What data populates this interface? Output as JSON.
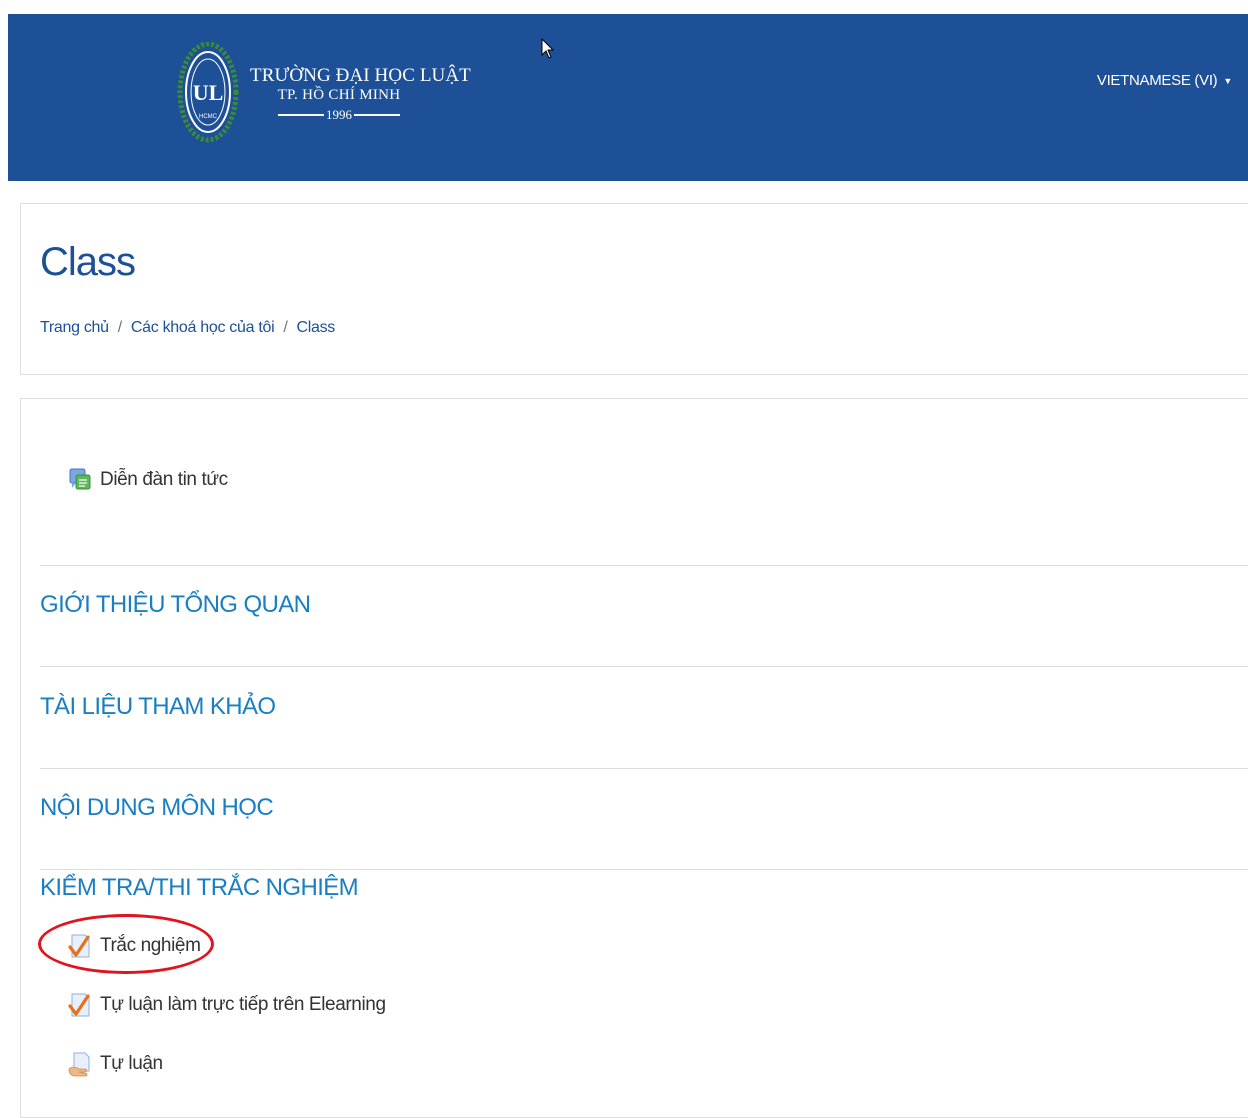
{
  "header": {
    "logo": {
      "emblem_letters": "UL",
      "emblem_caption": "HCMC",
      "line1": "TRƯỜNG ĐẠI HỌC LUẬT",
      "line2": "TP. HỒ CHÍ MINH",
      "year": "1996"
    },
    "language_label": "VIETNAMESE (VI)",
    "brand_color": "#1d5096"
  },
  "page": {
    "title": "Class",
    "breadcrumb": [
      "Trang chủ",
      "Các khoá học của tôi",
      "Class"
    ],
    "breadcrumb_separator": "/"
  },
  "course": {
    "forum": {
      "label": "Diễn đàn tin tức",
      "icon": "forum-icon"
    },
    "sections": [
      {
        "title": "GIỚI THIỆU TỔNG QUAN"
      },
      {
        "title": "TÀI LIỆU THAM KHẢO"
      },
      {
        "title": "NỘI DUNG MÔN HỌC"
      },
      {
        "title": "KIỂM TRA/THI TRẮC NGHIỆM",
        "activities": [
          {
            "label": "Trắc nghiệm",
            "icon": "quiz-icon",
            "highlighted": true
          },
          {
            "label": "Tự luận làm trực tiếp trên Elearning",
            "icon": "quiz-icon"
          },
          {
            "label": "Tự luận",
            "icon": "assignment-icon"
          }
        ]
      }
    ],
    "section_color": "#1a7ec4",
    "highlight_color": "#e0141e"
  }
}
